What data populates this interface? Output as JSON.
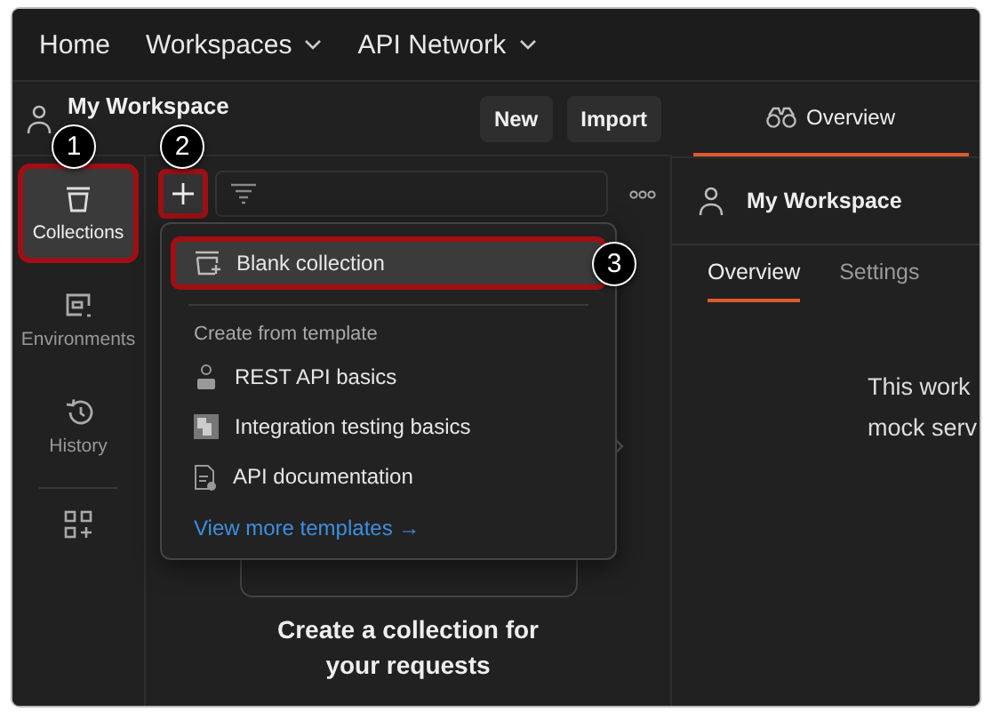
{
  "top_nav": [
    {
      "label": "Home",
      "dropdown": false
    },
    {
      "label": "Workspaces",
      "dropdown": true
    },
    {
      "label": "API Network",
      "dropdown": true
    }
  ],
  "workspace_header": {
    "title": "My Workspace",
    "buttons": [
      "New",
      "Import"
    ]
  },
  "rail": [
    {
      "kind": "collections",
      "label": "Collections",
      "selected": true,
      "highlighted": true
    },
    {
      "kind": "environments",
      "label": "Environments",
      "selected": false,
      "highlighted": false
    },
    {
      "kind": "history",
      "label": "History",
      "selected": false,
      "highlighted": false
    },
    {
      "kind": "apps"
    }
  ],
  "sidebar": {
    "add_button": {
      "highlighted": true
    },
    "empty_title": "Create a collection for your requests"
  },
  "menu": {
    "items": [
      {
        "kind": "blank",
        "label": "Blank collection",
        "highlighted": true
      }
    ],
    "section": "Create from template",
    "templates": [
      {
        "kind": "rest",
        "label": "REST API basics"
      },
      {
        "kind": "integration",
        "label": "Integration testing basics"
      },
      {
        "kind": "docs",
        "label": "API documentation"
      }
    ],
    "link": "View more templates →"
  },
  "right_panel": {
    "tab": "Overview",
    "workspace": "My Workspace",
    "tabs": [
      {
        "label": "Overview",
        "selected": true
      },
      {
        "label": "Settings",
        "selected": false
      }
    ],
    "lines": [
      "This work",
      "mock serv"
    ]
  },
  "callouts": [
    "1",
    "2",
    "3"
  ]
}
